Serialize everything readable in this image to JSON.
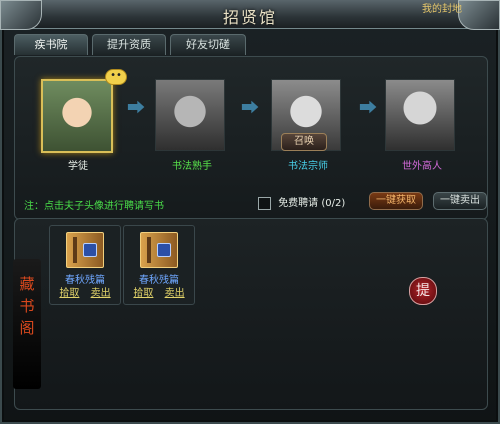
{
  "window": {
    "title": "招贤馆",
    "top_right_partial": "我的封地"
  },
  "tabs": [
    {
      "label": "疾书院",
      "active": true
    },
    {
      "label": "提升资质",
      "active": false
    },
    {
      "label": "好友切磋",
      "active": false
    }
  ],
  "portraits": [
    {
      "label": "学徒",
      "color": "#e8efe9",
      "selected": true,
      "badge": "••",
      "icon": "student-portrait"
    },
    {
      "label": "书法熟手",
      "color": "#57e04a",
      "selected": false,
      "icon": "skilled-calligrapher-portrait"
    },
    {
      "label": "书法宗师",
      "color": "#48cfe8",
      "selected": false,
      "button": "召唤",
      "icon": "calligraphy-master-portrait"
    },
    {
      "label": "世外高人",
      "color": "#d26ad8",
      "selected": false,
      "icon": "hermit-master-portrait"
    }
  ],
  "hint": "注：点击夫子头像进行聘请写书",
  "free_hire": {
    "label": "免费聘请",
    "value": "(0/2)",
    "checked": false
  },
  "buttons": {
    "one_click_get": "一键获取",
    "one_click_sell": "一键卖出"
  },
  "storehouse": {
    "label": "藏书阁",
    "items": [
      {
        "name": "春秋残篇",
        "pick": "拾取",
        "sell": "卖出",
        "icon": "book-icon"
      },
      {
        "name": "春秋残篇",
        "pick": "拾取",
        "sell": "卖出",
        "icon": "book-icon"
      }
    ],
    "mark": "提"
  }
}
